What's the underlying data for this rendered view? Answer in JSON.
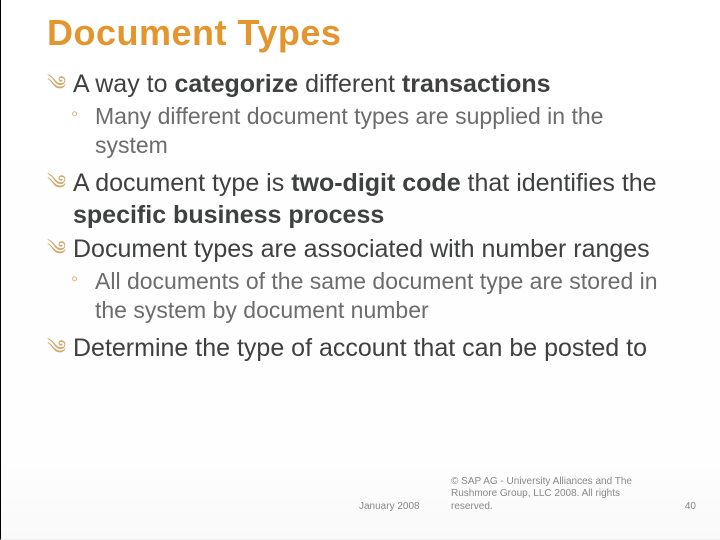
{
  "title": "Document Types",
  "bullets": {
    "b1_pre": "A way to ",
    "b1_bold1": "categorize",
    "b1_mid": " different ",
    "b1_bold2": "transactions",
    "s1": "Many different document types are supplied in the system",
    "b2_pre": "A document type is ",
    "b2_bold1": "two-digit code",
    "b2_mid": " that identifies the ",
    "b2_bold2": "specific business process",
    "b3": "Document types are associated with number ranges",
    "s2": "All documents of the same document type are stored in the system by document number",
    "b4": "Determine the type of account that can be posted to"
  },
  "footer": {
    "date": "January 2008",
    "copy": "© SAP AG - University Alliances and The Rushmore Group, LLC 2008. All rights reserved.",
    "page": "40"
  }
}
